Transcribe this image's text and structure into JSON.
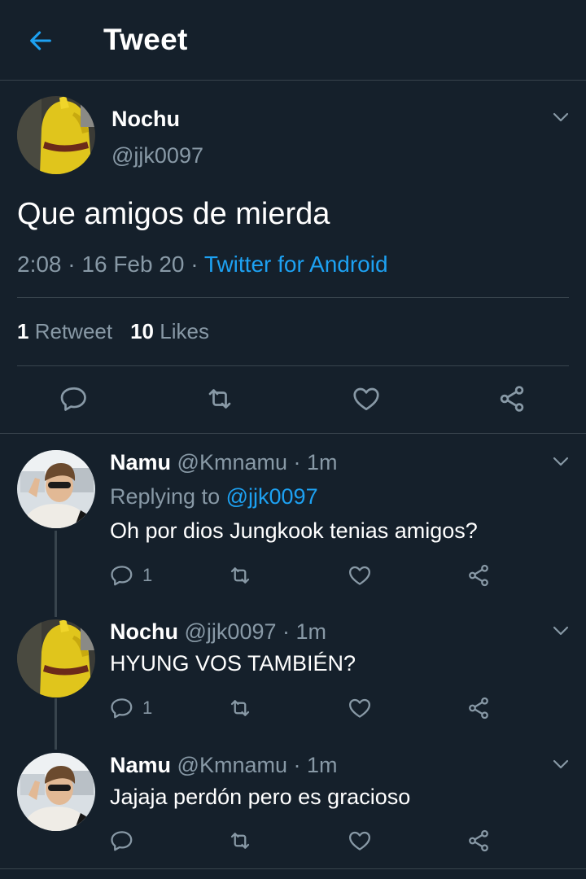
{
  "header": {
    "title": "Tweet",
    "back_icon": "arrow-left-icon"
  },
  "colors": {
    "background": "#15202b",
    "accent": "#1da1f2",
    "muted": "#8899a6",
    "divider": "#38444d"
  },
  "tweet": {
    "name": "Nochu",
    "handle": "@jjk0097",
    "text": "Que amigos de mierda",
    "time": "2:08",
    "dot": "·",
    "date": "16 Feb 20",
    "client": "Twitter for Android",
    "retweet_count": "1",
    "retweet_label": "Retweet",
    "like_count": "10",
    "like_label": "Likes"
  },
  "replies": [
    {
      "name": "Namu",
      "handle": "@Kmnamu",
      "time": "1m",
      "replying_prefix": "Replying to",
      "replying_to": "@jjk0097",
      "text": "Oh por dios Jungkook tenias amigos?",
      "reply_count": "1"
    },
    {
      "name": "Nochu",
      "handle": "@jjk0097",
      "time": "1m",
      "text": "HYUNG VOS TAMBIÉN?",
      "reply_count": "1"
    },
    {
      "name": "Namu",
      "handle": "@Kmnamu",
      "time": "1m",
      "text": "Jajaja perdón pero es gracioso"
    }
  ]
}
